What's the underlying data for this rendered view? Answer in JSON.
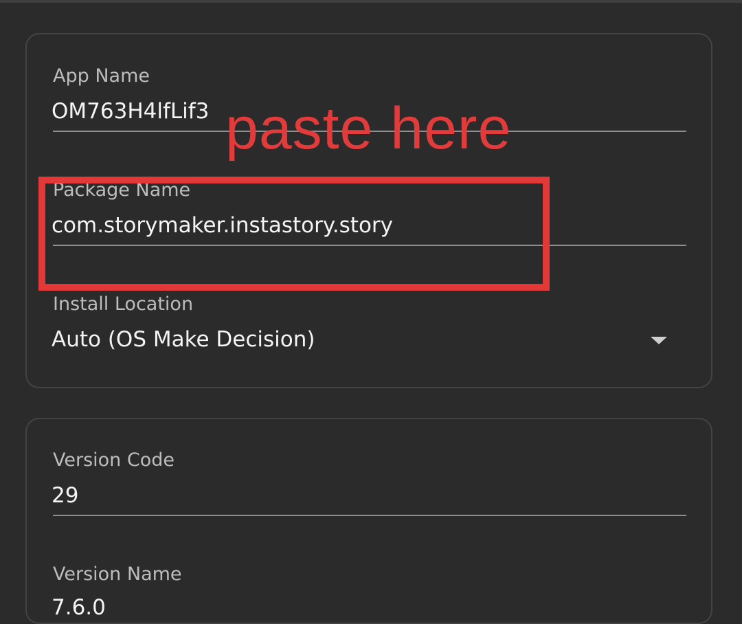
{
  "form": {
    "app_name": {
      "label": "App Name",
      "value": "OM763H4lfLif3"
    },
    "package_name": {
      "label": "Package Name",
      "value": "com.storymaker.instastory.story"
    },
    "install_location": {
      "label": "Install Location",
      "value": "Auto (OS Make Decision)",
      "icon": "chevron-down-icon"
    },
    "version_code": {
      "label": "Version Code",
      "value": "29"
    },
    "version_name": {
      "label": "Version Name",
      "value": "7.6.0"
    }
  },
  "annotation": {
    "text": "paste here",
    "color": "#e23b3b"
  },
  "colors": {
    "background": "#2b2b2b",
    "card_border": "#444444",
    "label": "#bdbdbd",
    "value": "#f4f4f4",
    "underline": "#8e8e8e"
  }
}
